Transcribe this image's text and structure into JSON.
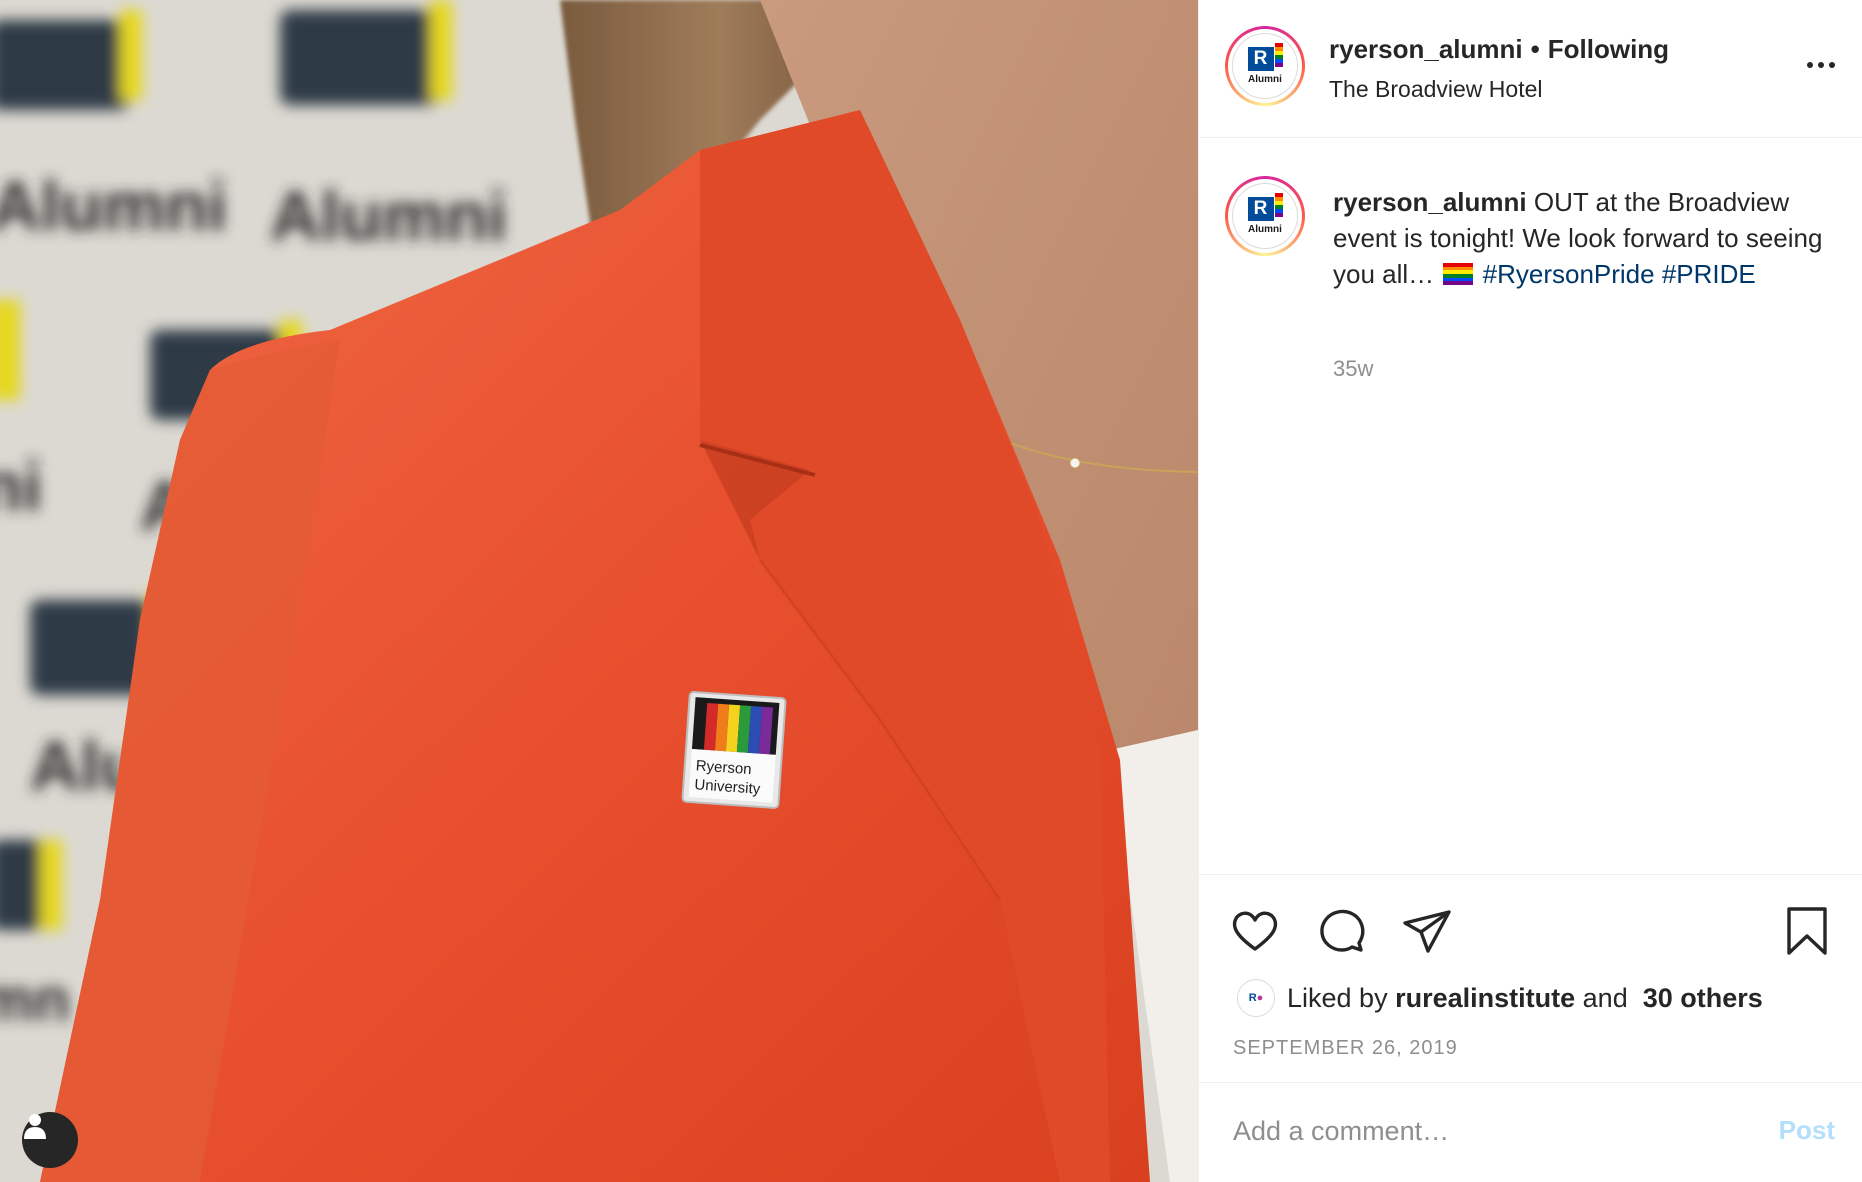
{
  "post": {
    "username": "ryerson_alumni",
    "follow_status": "Following",
    "separator": "•",
    "location": "The Broadview Hotel",
    "avatar_logo_letter": "R",
    "avatar_logo_word": "Alumni"
  },
  "photo": {
    "pin_text_line1": "Ryerson",
    "pin_text_line2": "University",
    "user_tag_icon": "user-icon"
  },
  "caption": {
    "username": "ryerson_alumni",
    "text": " OUT at the Broadview event is tonight! We look forward to seeing you all… ",
    "emoji": "rainbow-flag",
    "hashtag1": "#RyersonPride",
    "hashtag2": "#PRIDE",
    "age": "35w"
  },
  "actions": {
    "like_icon": "heart-icon",
    "comment_icon": "comment-icon",
    "share_icon": "paper-plane-icon",
    "save_icon": "bookmark-icon"
  },
  "likes": {
    "prefix": "Liked by",
    "liker": "rurealinstitute",
    "conjunction": "and",
    "others": "30 others"
  },
  "date": "SEPTEMBER 26, 2019",
  "comment": {
    "placeholder": "Add a comment…",
    "post_label": "Post"
  },
  "colors": {
    "link": "#00376b",
    "muted": "#8e8e8e",
    "post_disabled": "#b2dffc",
    "blazer": "#e8502f",
    "logo_blue": "#004c9b"
  }
}
